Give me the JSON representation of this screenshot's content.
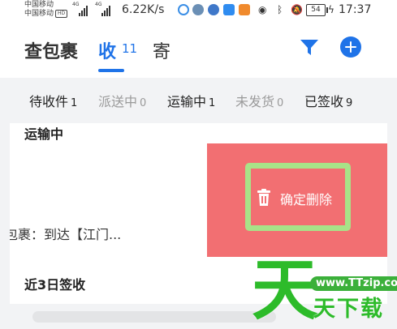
{
  "status_bar": {
    "carrier_1": "中国移动",
    "carrier_2": "中国移动",
    "hd_badge": "HD",
    "signal_1_tag": "4G",
    "signal_2_tag": "4G",
    "net_speed": "6.22K/s",
    "battery": "54",
    "time": "17:37"
  },
  "header": {
    "title": "查包裹",
    "tabs": [
      {
        "label": "收",
        "count": "11",
        "active": true
      },
      {
        "label": "寄",
        "active": false
      }
    ],
    "accent_color": "#1f73e8"
  },
  "status_filters": [
    {
      "label": "待收件",
      "count": "1",
      "muted": false
    },
    {
      "label": "派送中",
      "count": "0",
      "muted": true
    },
    {
      "label": "运输中",
      "count": "1",
      "muted": false
    },
    {
      "label": "未发货",
      "count": "0",
      "muted": true
    },
    {
      "label": "已签收",
      "count": "9",
      "muted": false
    }
  ],
  "sections": {
    "in_transit_title": "运输中",
    "package_status": "包裹：到达【江门...",
    "recent_title": "近3日签收"
  },
  "swipe_action": {
    "label": "确定删除",
    "icon": "trash-icon",
    "background_color": "#f26f72",
    "highlight_color": "#a8e388"
  },
  "watermark": {
    "glyph": "天",
    "url": "www.TTzip.com",
    "text": "天下载",
    "color": "#2dbb2a"
  }
}
